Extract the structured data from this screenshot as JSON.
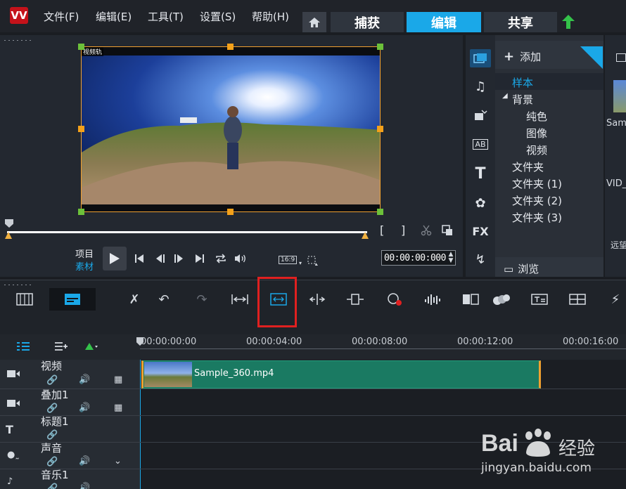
{
  "menu": {
    "items": [
      "文件(F)",
      "编辑(E)",
      "工具(T)",
      "设置(S)",
      "帮助(H)"
    ],
    "tabs": [
      "捕获",
      "编辑",
      "共享"
    ],
    "active_tab": "编辑"
  },
  "preview": {
    "track_label": "视频轨",
    "mode_project": "项目",
    "mode_clip": "素材",
    "aspect_ratio": "16:9",
    "timecode": "00:00:00:000",
    "bracket_in": "[",
    "bracket_out": "]"
  },
  "library": {
    "add_label": "添加",
    "tree": [
      {
        "label": "样本",
        "selected": true
      },
      {
        "label": "背景",
        "expanded": true
      },
      {
        "label": "纯色",
        "child": true
      },
      {
        "label": "图像",
        "child": true
      },
      {
        "label": "视频",
        "child": true
      },
      {
        "label": "文件夹"
      },
      {
        "label": "文件夹 (1)"
      },
      {
        "label": "文件夹 (2)"
      },
      {
        "label": "文件夹 (3)"
      }
    ],
    "browse_label": "浏览",
    "thumb_labels": [
      "Sam",
      "VID_",
      "远望"
    ],
    "fx_label": "FX",
    "title_label": "T",
    "ab_label": "AB"
  },
  "timeline": {
    "ruler": [
      "00:00:00:00",
      "00:00:04:00",
      "00:00:08:00",
      "00:00:12:00",
      "00:00:16:00"
    ],
    "tracks": [
      "视频",
      "叠加1",
      "标题1",
      "声音",
      "音乐1"
    ],
    "clip_name": "Sample_360.mp4"
  },
  "watermark": {
    "brand": "Bai",
    "brand2": "经验",
    "url": "jingyan.baidu.com"
  },
  "colors": {
    "accent": "#1aa8e8",
    "clip": "#1a7a62",
    "handle": "#f4a11a",
    "highlight": "#e02020"
  }
}
